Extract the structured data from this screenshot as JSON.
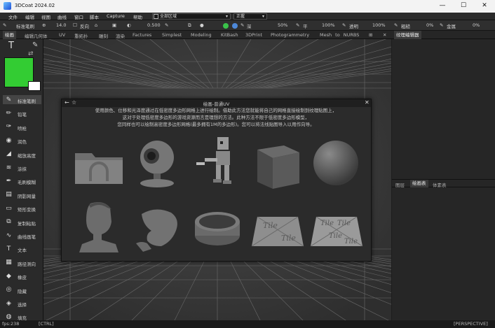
{
  "window": {
    "title": "3DCoat 2024.02",
    "minimize": "—",
    "maximize": "☐",
    "close": "✕"
  },
  "menu": {
    "items": [
      "文件",
      "编辑",
      "视图",
      "曲线",
      "窗口",
      "脚本",
      "Capture",
      "帮助"
    ],
    "region_dropdown": "全部区域",
    "mode_dropdown": "正握"
  },
  "toolbar": {
    "brush_name": "标准笔刷",
    "size_value": "14.0",
    "invert_label": "反向",
    "value_0500": "0.500",
    "depth_label": "深",
    "depth_value": "50%",
    "smooth_label": "平",
    "smooth_value": "100%",
    "opacity_label": "透明",
    "opacity_value": "100%",
    "rough_label": "粗糙",
    "rough_value": "0%",
    "metal_label": "金属",
    "metal_value": "0%"
  },
  "tabs": [
    "绘画",
    "编辑几何体",
    "UV",
    "重拓扑",
    "雕刻",
    "渲染",
    "Factures",
    "Simplest",
    "Modeling",
    "KitBash",
    "3DPrint",
    "Photogrammetry",
    "Mesh to NURBS"
  ],
  "right_panel": {
    "top_tab": "纹理编辑器",
    "bottom_tabs": [
      "图层",
      "绘画表",
      "体素表"
    ]
  },
  "colors": {
    "primary_color": "#33cc33",
    "accent": "#3a3a3a"
  },
  "left_tools": [
    {
      "icon": "brush-icon",
      "label": "标准笔刷"
    },
    {
      "icon": "pencil-icon",
      "label": "铅笔"
    },
    {
      "icon": "airbrush-icon",
      "label": "喷枪"
    },
    {
      "icon": "fill-icon",
      "label": "润色"
    },
    {
      "icon": "scale-icon",
      "label": "缩放高度"
    },
    {
      "icon": "smear-icon",
      "label": "涂抹"
    },
    {
      "icon": "clone-icon",
      "label": "毛刷模糊"
    },
    {
      "icon": "hatch-icon",
      "label": "阴影网量"
    },
    {
      "icon": "rect-icon",
      "label": "矩形变换"
    },
    {
      "icon": "copy-icon",
      "label": "复制粘贴"
    },
    {
      "icon": "spline-icon",
      "label": "曲线画笔"
    },
    {
      "icon": "text-icon",
      "label": "文本"
    },
    {
      "icon": "path-icon",
      "label": "路径测向"
    },
    {
      "icon": "eraser-icon",
      "label": "橡皮"
    },
    {
      "icon": "hide-icon",
      "label": "隐藏"
    },
    {
      "icon": "select-icon",
      "label": "选择"
    },
    {
      "icon": "fill-bucket-icon",
      "label": "填充"
    }
  ],
  "dialog": {
    "title": "绘画-普通UV",
    "description": [
      "使用颜色、位移和光泽度通过在低密度多边形网格上进行绘制。借助此方法您就能将自己的网格直接绘制到纹理贴图上，",
      "这对于处理低密度多边形的游戏资源而言是理想的方法。此种方法不限于低密度多边形模型，",
      "您同样也可以绘制高密度多边形网格(最多拥有1M的多边形)。您可以将法线贴图导入以用作向导。"
    ],
    "samples": [
      "folder",
      "webcam",
      "robot",
      "cube",
      "sphere",
      "head",
      "hand",
      "ring",
      "tile-plane-1",
      "tile-plane-2"
    ],
    "tile_text": "Tile"
  },
  "status": {
    "fps": "fps:238",
    "modifier": "[CTRL]",
    "view_mode": "[PERSPECTIVE]"
  }
}
